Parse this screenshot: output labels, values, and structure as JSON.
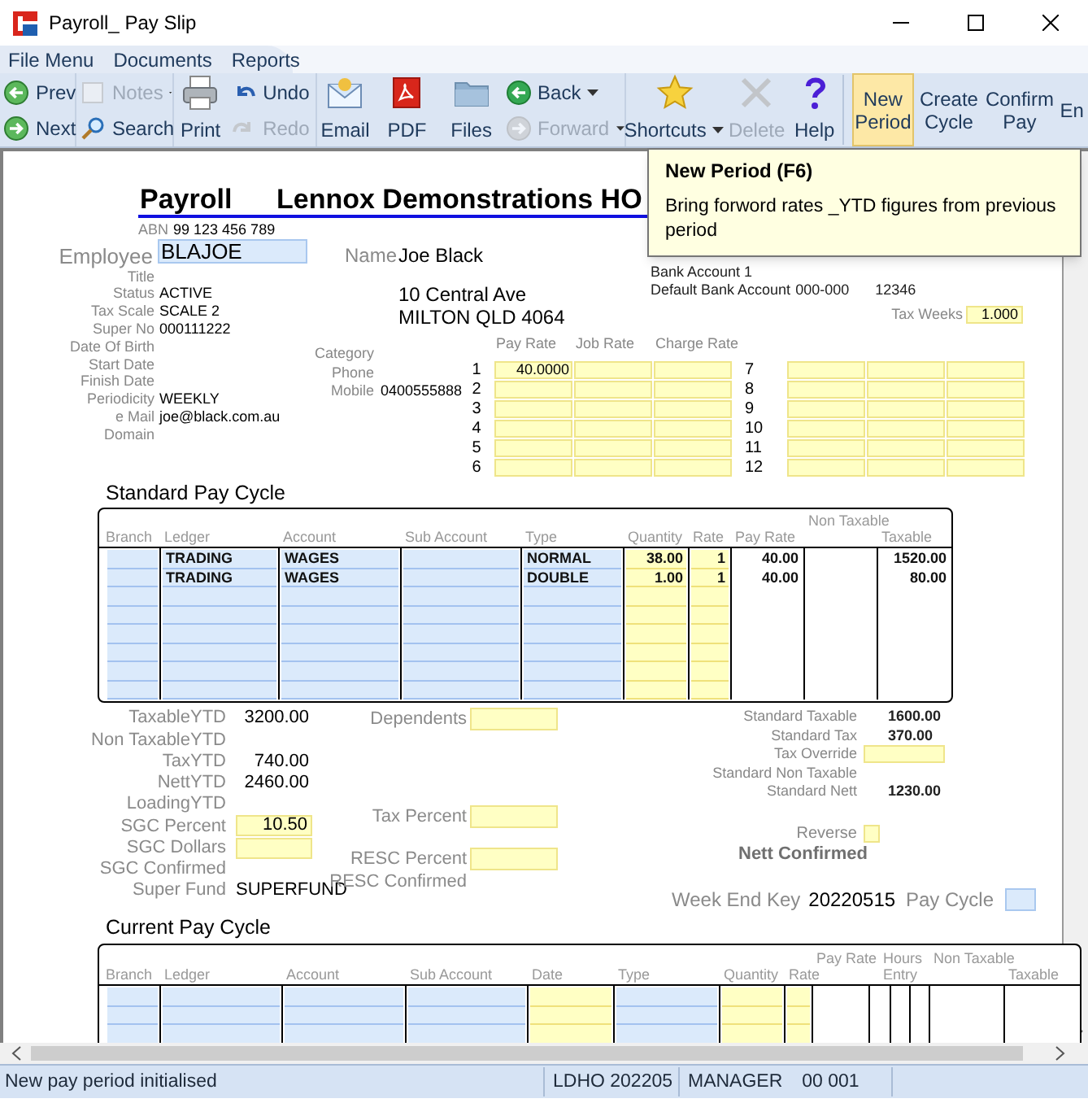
{
  "window": {
    "title": "Payroll_ Pay Slip"
  },
  "menu": [
    "File Menu",
    "Documents",
    "Reports"
  ],
  "toolbar": [
    {
      "kind": "stack",
      "items": [
        {
          "label": "Prev",
          "disabled": false
        },
        {
          "label": "Next",
          "disabled": false
        }
      ]
    },
    {
      "kind": "stack",
      "items": [
        {
          "label": "Notes",
          "disabled": true,
          "dropdown": true
        },
        {
          "label": "Search",
          "disabled": false
        }
      ]
    },
    {
      "kind": "large",
      "label": "Print",
      "disabled": false
    },
    {
      "kind": "stack",
      "items": [
        {
          "label": "Undo",
          "disabled": false
        },
        {
          "label": "Redo",
          "disabled": true
        }
      ]
    },
    {
      "kind": "large",
      "label": "Email",
      "disabled": false
    },
    {
      "kind": "large",
      "label": "PDF",
      "disabled": false
    },
    {
      "kind": "large",
      "label": "Files",
      "disabled": false
    },
    {
      "kind": "stack",
      "items": [
        {
          "label": "Back",
          "disabled": false,
          "dropdown": true
        },
        {
          "label": "Forward",
          "disabled": true,
          "dropdown": true
        }
      ]
    },
    {
      "kind": "large",
      "label": "Shortcuts",
      "disabled": false,
      "dropdown": true
    },
    {
      "kind": "large",
      "label": "Delete",
      "disabled": true
    },
    {
      "kind": "large",
      "label": "Help",
      "disabled": false
    },
    {
      "kind": "text",
      "label": "New Period",
      "selected": true
    },
    {
      "kind": "text",
      "label": "Create Cycle",
      "selected": false
    },
    {
      "kind": "text",
      "label": "Confirm Pay",
      "selected": false
    },
    {
      "kind": "text",
      "label": "En",
      "selected": false
    }
  ],
  "tooltip": {
    "title": "New Period (F6)",
    "text": "Bring forword rates _YTD figures from previous period"
  },
  "header": {
    "title": "Payroll",
    "company": "Lennox Demonstrations HO",
    "abn_label": "ABN",
    "abn": "99 123 456 789"
  },
  "employee": {
    "label": "Employee",
    "code": "BLAJOE",
    "name_label": "Name",
    "name": "Joe Black",
    "details": [
      {
        "label": "Title"
      },
      {
        "label": "Status",
        "value": "ACTIVE"
      },
      {
        "label": "Tax Scale",
        "value": "SCALE 2"
      },
      {
        "label": "Super No",
        "value": "000111222"
      },
      {
        "label": "Date Of Birth"
      },
      {
        "label": "Start Date"
      },
      {
        "label": "Finish Date"
      },
      {
        "label": "Periodicity",
        "value": "WEEKLY"
      },
      {
        "label": "e Mail",
        "value": "joe@black.com.au"
      },
      {
        "label": "Domain"
      }
    ],
    "contact": [
      {
        "label": "Category"
      },
      {
        "label": "Phone"
      },
      {
        "label": "Mobile",
        "value": "0400555888"
      }
    ],
    "address": [
      "10 Central Ave",
      "MILTON QLD 4064"
    ]
  },
  "bank": {
    "account": "Bank Account 1",
    "default_label": "Default Bank Account",
    "default": "000-000",
    "number": "12346"
  },
  "tax_weeks": {
    "label": "Tax Weeks",
    "value": "1.000"
  },
  "rates": {
    "columns": [
      "Pay Rate",
      "Job Rate",
      "Charge Rate"
    ],
    "rows": [
      {
        "number": "1",
        "pay_rate": "40.0000"
      },
      {
        "number": "2"
      },
      {
        "number": "3"
      },
      {
        "number": "4"
      },
      {
        "number": "5"
      },
      {
        "number": "6"
      },
      {
        "number": "7"
      },
      {
        "number": "8"
      },
      {
        "number": "9"
      },
      {
        "number": "10"
      },
      {
        "number": "11"
      },
      {
        "number": "12"
      }
    ]
  },
  "standard_pay_cycle": {
    "title": "Standard Pay Cycle",
    "columns": [
      {
        "label": "Branch",
        "kind": "lookup"
      },
      {
        "label": "Ledger",
        "kind": "lookup"
      },
      {
        "label": "Account",
        "kind": "lookup"
      },
      {
        "label": "Sub Account",
        "kind": "lookup"
      },
      {
        "label": "Type",
        "kind": "lookup"
      },
      {
        "label": "Quantity",
        "kind": "entry"
      },
      {
        "label": "Rate",
        "kind": "entry"
      },
      {
        "label": "Pay Rate",
        "kind": "computed"
      },
      {
        "top": "Non Taxable",
        "kind": "computed"
      },
      {
        "label": "Taxable",
        "kind": "computed"
      }
    ],
    "rows": [
      {
        "ledger": "TRADING",
        "account": "WAGES",
        "type": "NORMAL",
        "quantity": "38.00",
        "rate": "1",
        "pay_rate": "40.00",
        "taxable": "1520.00"
      },
      {
        "ledger": "TRADING",
        "account": "WAGES",
        "type": "DOUBLE",
        "quantity": "1.00",
        "rate": "1",
        "pay_rate": "40.00",
        "taxable": "80.00"
      }
    ]
  },
  "ytd": [
    {
      "label": "TaxableYTD",
      "value": "3200.00",
      "kind": "number"
    },
    {
      "label": "Non TaxableYTD",
      "kind": "number"
    },
    {
      "label": "TaxYTD",
      "value": "740.00",
      "kind": "number"
    },
    {
      "label": "NettYTD",
      "value": "2460.00",
      "kind": "number"
    },
    {
      "label": "LoadingYTD",
      "kind": "number"
    },
    {
      "label": "SGC Percent",
      "value": "10.50",
      "kind": "field"
    },
    {
      "label": "SGC Dollars",
      "kind": "field"
    },
    {
      "label": "SGC Confirmed",
      "kind": "number"
    },
    {
      "label": "Super Fund",
      "value": "SUPERFUND",
      "kind": "text"
    }
  ],
  "tax_fields": [
    {
      "label": "Dependents",
      "kind": "field"
    },
    {
      "label": "Tax Percent",
      "kind": "field"
    },
    {
      "label": "RESC Percent",
      "kind": "field"
    },
    {
      "label": "RESC Confirmed",
      "kind": "text"
    }
  ],
  "totals": [
    {
      "label": "Standard Taxable",
      "value": "1600.00",
      "kind": "number"
    },
    {
      "label": "Standard Tax",
      "value": "370.00",
      "kind": "number"
    },
    {
      "label": "Tax Override",
      "kind": "field"
    },
    {
      "label": "Standard Non Taxable",
      "kind": "number"
    },
    {
      "label": "Standard Nett",
      "value": "1230.00",
      "kind": "number"
    }
  ],
  "reverse": {
    "label": "Reverse",
    "checked": false
  },
  "nett_confirmed": "Nett Confirmed",
  "week_end": {
    "label": "Week End Key",
    "value": "20220515"
  },
  "pay_cycle": {
    "label": "Pay Cycle"
  },
  "current_pay_cycle": {
    "title": "Current Pay Cycle",
    "columns": [
      {
        "label": "Branch",
        "kind": "lookup"
      },
      {
        "label": "Ledger",
        "kind": "lookup"
      },
      {
        "label": "Account",
        "kind": "lookup"
      },
      {
        "label": "Sub Account",
        "kind": "lookup"
      },
      {
        "label": "Date",
        "kind": "entry"
      },
      {
        "label": "Type",
        "kind": "lookup"
      },
      {
        "label": "Quantity",
        "kind": "entry"
      },
      {
        "label": "Rate",
        "kind": "entry"
      },
      {
        "top": "Pay Rate",
        "kind": "computed"
      },
      {
        "top": "Hours",
        "label": "Entry",
        "kind": "computed"
      },
      {
        "kind": "computed"
      },
      {
        "kind": "computed"
      },
      {
        "top": "Non Taxable",
        "kind": "computed"
      },
      {
        "label": "Taxable",
        "kind": "computed"
      }
    ]
  },
  "status_bar": {
    "message": "New pay period initialised",
    "company": "LDHO 202205",
    "user": "MANAGER",
    "code": "00 001"
  }
}
